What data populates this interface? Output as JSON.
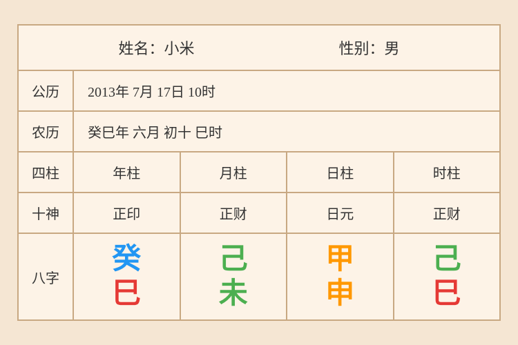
{
  "header": {
    "name_label": "姓名：小米",
    "gender_label": "性别：男"
  },
  "solar_row": {
    "label": "公历",
    "value": "2013年 7月 17日 10时"
  },
  "lunar_row": {
    "label": "农历",
    "value": "癸巳年 六月 初十 巳时"
  },
  "pillar_row": {
    "label": "四柱",
    "columns": [
      "年柱",
      "月柱",
      "日柱",
      "时柱"
    ]
  },
  "shishen_row": {
    "label": "十神",
    "columns": [
      "正印",
      "正财",
      "日元",
      "正财"
    ]
  },
  "bazi_row": {
    "label": "八字",
    "columns": [
      {
        "top": "癸",
        "bottom": "巳",
        "top_color": "blue",
        "bottom_color": "red"
      },
      {
        "top": "己",
        "bottom": "未",
        "top_color": "green",
        "bottom_color": "green"
      },
      {
        "top": "甲",
        "bottom": "申",
        "top_color": "orange",
        "bottom_color": "orange"
      },
      {
        "top": "己",
        "bottom": "巳",
        "top_color": "green2",
        "bottom_color": "red"
      }
    ]
  }
}
